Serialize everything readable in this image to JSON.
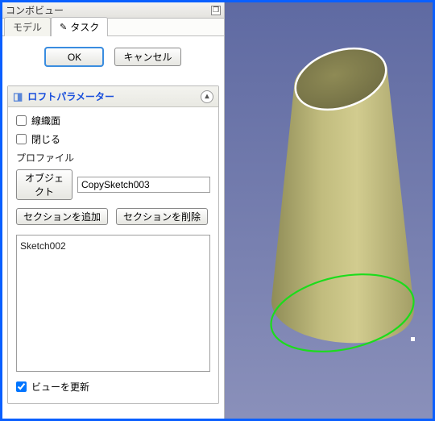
{
  "panel": {
    "title": "コンボビュー"
  },
  "tabs": {
    "model": "モデル",
    "task": "タスク"
  },
  "dialog": {
    "ok": "OK",
    "cancel": "キャンセル"
  },
  "loft": {
    "title": "ロフトパラメーター",
    "ruled": "線織面",
    "closed": "閉じる",
    "profile_label": "プロファイル",
    "object_btn": "オブジェクト",
    "profile_value": "CopySketch003",
    "add_section": "セクションを追加",
    "remove_section": "セクションを削除",
    "sections": [
      "Sketch002"
    ],
    "update_view": "ビューを更新",
    "update_checked": true,
    "ruled_checked": false,
    "closed_checked": false
  }
}
